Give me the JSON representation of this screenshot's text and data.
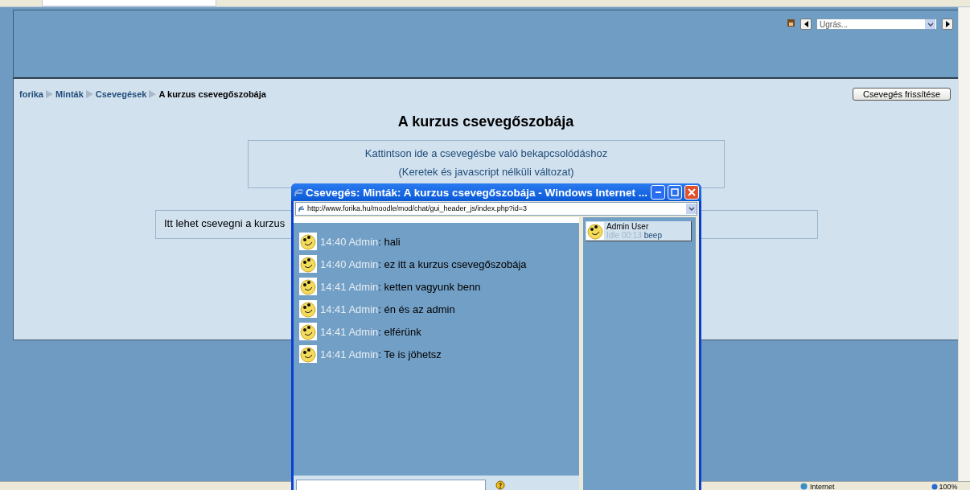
{
  "header": {
    "jump_menu": {
      "value": "Ugrás..."
    }
  },
  "breadcrumb": [
    {
      "label": "forika",
      "kind": "link"
    },
    {
      "label": "Minták",
      "kind": "link"
    },
    {
      "label": "Csevegések",
      "kind": "link"
    },
    {
      "label": "A kurzus csevegőszobája",
      "kind": "current"
    }
  ],
  "refresh_button": "Csevegés frissítése",
  "heading": "A kurzus csevegőszobája",
  "join_links": [
    "Kattintson ide a csevegésbe való bekapcsolódáshoz",
    "(Keretek és javascript nélküli változat)"
  ],
  "intro": "Itt lehet csevegni a kurzus",
  "chat_window": {
    "title": "Csevegés: Minták: A kurzus csevegőszobája - Windows Internet ...",
    "address": "http://www.forika.hu/moodle/mod/chat/gui_header_js/index.php?id=3",
    "messages": [
      {
        "time": "14:40",
        "author": "Admin",
        "text": ": hali"
      },
      {
        "time": "14:40",
        "author": "Admin",
        "text": ": ez itt a kurzus csevegőszobája"
      },
      {
        "time": "14:41",
        "author": "Admin",
        "text": ": ketten vagyunk benn"
      },
      {
        "time": "14:41",
        "author": "Admin",
        "text": ": én és az admin"
      },
      {
        "time": "14:41",
        "author": "Admin",
        "text": ": elférünk"
      },
      {
        "time": "14:41",
        "author": "Admin",
        "text": ": Te is jöhetsz"
      }
    ],
    "users": [
      {
        "name": "Admin User",
        "idle": "Idle 00:13",
        "action": "beep"
      }
    ]
  },
  "status_bar": {
    "zone": "Internet",
    "zoom": "100%"
  }
}
